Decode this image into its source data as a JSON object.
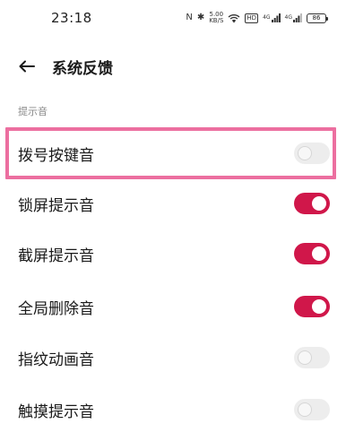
{
  "status_bar": {
    "time": "23:18",
    "nfc_icon": "N",
    "bluetooth_icon": "✱",
    "speed_value": "5.00",
    "speed_unit": "KB/S",
    "hd_label": "HD",
    "signal1_label": "4G",
    "signal2_label": "4G",
    "battery_level": "86"
  },
  "header": {
    "title": "系统反馈",
    "back_icon": "arrow-left-icon"
  },
  "section": {
    "label": "提示音"
  },
  "settings": [
    {
      "label": "拨号按键音",
      "enabled": false
    },
    {
      "label": "锁屏提示音",
      "enabled": true
    },
    {
      "label": "截屏提示音",
      "enabled": true
    },
    {
      "label": "全局删除音",
      "enabled": true
    },
    {
      "label": "指纹动画音",
      "enabled": false
    },
    {
      "label": "触摸提示音",
      "enabled": false
    }
  ],
  "colors": {
    "toggle_on": "#d0174a",
    "toggle_off": "#ededed",
    "highlight": "#ec6fa0"
  }
}
